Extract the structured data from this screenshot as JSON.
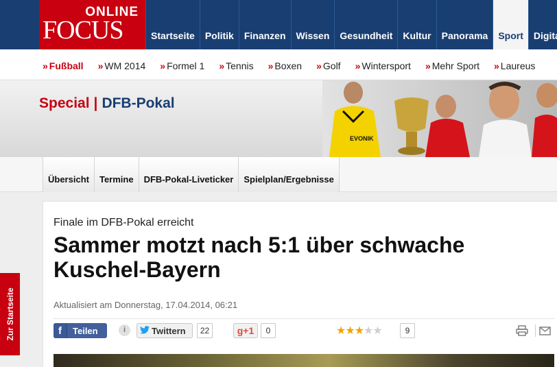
{
  "logo": {
    "online": "ONLINE",
    "focus": "FOCUS"
  },
  "topnav": {
    "items": [
      {
        "label": "Startseite"
      },
      {
        "label": "Politik"
      },
      {
        "label": "Finanzen"
      },
      {
        "label": "Wissen"
      },
      {
        "label": "Gesundheit"
      },
      {
        "label": "Kultur"
      },
      {
        "label": "Panorama"
      },
      {
        "label": "Sport",
        "active": true
      },
      {
        "label": "Digital"
      }
    ]
  },
  "subnav": {
    "items": [
      {
        "label": "Fußball",
        "active": true
      },
      {
        "label": "WM 2014"
      },
      {
        "label": "Formel 1"
      },
      {
        "label": "Tennis"
      },
      {
        "label": "Boxen"
      },
      {
        "label": "Golf"
      },
      {
        "label": "Wintersport"
      },
      {
        "label": "Mehr Sport"
      },
      {
        "label": "Laureus"
      }
    ],
    "marker": "»"
  },
  "header": {
    "special": "Special",
    "separator": "|",
    "section": "DFB-Pokal"
  },
  "tabs": [
    "Übersicht",
    "Termine",
    "DFB-Pokal-Liveticker",
    "Spielplan/Ergebnisse"
  ],
  "article": {
    "kicker": "Finale im DFB-Pokal erreicht",
    "headline": "Sammer motzt nach 5:1 über schwache Kuschel-Bayern",
    "updated": "Aktualisiert am Donnerstag, 17.04.2014, 06:21"
  },
  "social": {
    "facebook_label": "Teilen",
    "info_glyph": "i",
    "twitter_label": "Twittern",
    "twitter_count": "22",
    "gplus_label": "g+1",
    "gplus_count": "0",
    "rating_stars_filled": 3,
    "rating_stars_total": 5,
    "rating_count": "9"
  },
  "sidetab": {
    "label": "Zur Startseite"
  },
  "colors": {
    "brand_red": "#c8000f",
    "nav_blue": "#193e72",
    "star": "#f0a500"
  },
  "icons": [
    "facebook-icon",
    "info-icon",
    "twitter-icon",
    "star-icon",
    "print-icon",
    "mail-icon"
  ]
}
